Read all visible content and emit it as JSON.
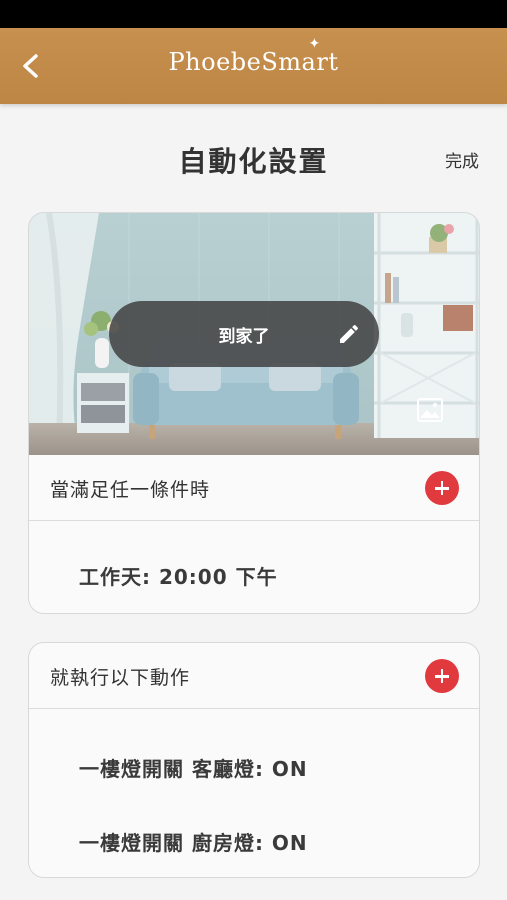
{
  "header": {
    "back_icon": "chevron-left-icon",
    "logo_text": "PhoebeSmart"
  },
  "page": {
    "title": "自動化設置",
    "done_label": "完成"
  },
  "scene": {
    "name": "到家了",
    "edit_icon": "pencil-icon",
    "image_icon": "image-icon"
  },
  "conditions": {
    "header": "當滿足任一條件時",
    "items": [
      "工作天: 20:00 下午"
    ]
  },
  "actions": {
    "header": "就執行以下動作",
    "items": [
      "一樓燈開關 客廳燈: ON",
      "一樓燈開關 廚房燈: ON"
    ]
  },
  "colors": {
    "app_bar": "#c28a4a",
    "add_button": "#e0393e"
  }
}
